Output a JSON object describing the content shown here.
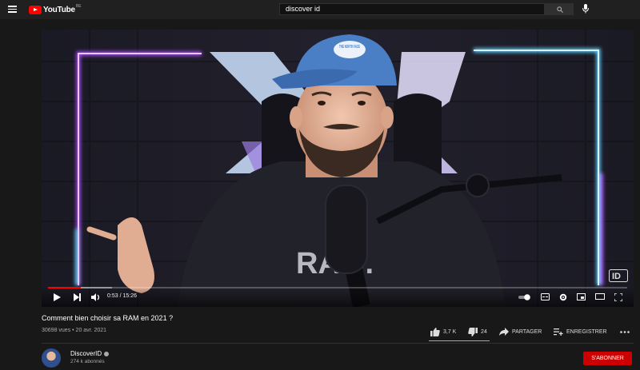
{
  "header": {
    "logo_text": "YouTube",
    "logo_country": "BE",
    "search_value": "discover id",
    "icons": [
      "menu-icon",
      "search-icon",
      "mic-icon"
    ]
  },
  "player": {
    "current_time": "0:53",
    "duration": "15:26",
    "time_separator": " / ",
    "progress_fraction": 0.057,
    "buffer_fraction": 0.11,
    "shirt_text": "RAW.",
    "cap_logo_text": "THE NORTH FACE",
    "watermark_text": "ID",
    "icons": [
      "play-icon",
      "next-icon",
      "volume-icon",
      "autoplay-toggle",
      "subtitles-icon",
      "settings-icon",
      "miniplayer-icon",
      "theater-icon",
      "fullscreen-icon"
    ]
  },
  "video": {
    "title": "Comment bien choisir sa RAM en 2021 ?",
    "views": "30698 vues",
    "stats_separator": " • ",
    "date": "20 avr. 2021",
    "likes": "3,7 K",
    "dislikes": "24",
    "share_label": "PARTAGER",
    "save_label": "ENREGISTRER"
  },
  "channel": {
    "name": "DiscoverID",
    "subscribers": "274 k abonnés",
    "subscribe_label": "S'ABONNER"
  },
  "colors": {
    "background": "#181818",
    "topbar": "#202020",
    "brand_red": "#ff0000",
    "subscribe": "#cc0000",
    "neon_purple": "#b04cff",
    "neon_blue": "#5fd0ff"
  }
}
